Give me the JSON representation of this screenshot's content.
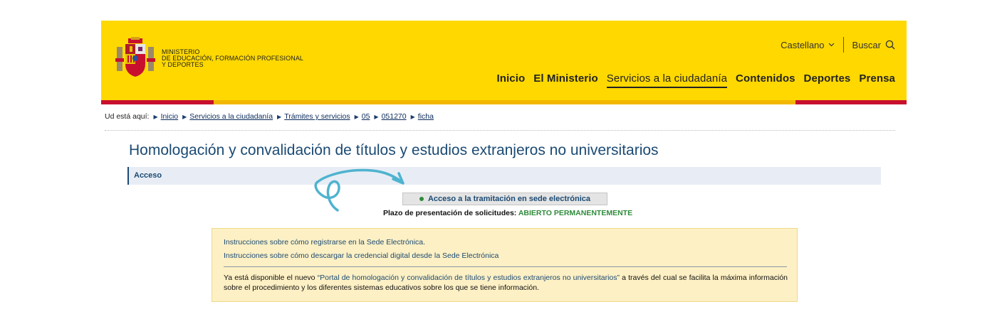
{
  "header": {
    "ministry_lines": [
      "MINISTERIO",
      "DE EDUCACIÓN, FORMACIÓN PROFESIONAL",
      "Y DEPORTES"
    ],
    "language": "Castellano",
    "search_label": "Buscar",
    "nav": [
      {
        "label": "Inicio",
        "active": false
      },
      {
        "label": "El Ministerio",
        "active": false
      },
      {
        "label": "Servicios a la ciudadanía",
        "active": true
      },
      {
        "label": "Contenidos",
        "active": false
      },
      {
        "label": "Deportes",
        "active": false
      },
      {
        "label": "Prensa",
        "active": false
      }
    ]
  },
  "breadcrumb": {
    "label": "Ud está aquí:",
    "items": [
      "Inicio",
      "Servicios a la ciudadanía",
      "Trámites y servicios",
      "05",
      "051270",
      "ficha"
    ]
  },
  "page": {
    "title": "Homologación y convalidación de títulos y estudios extranjeros no universitarios",
    "access_label": "Acceso",
    "tram_button": "Acceso a la tramitación en sede electrónica",
    "plazo_label": "Plazo de presentación de solicitudes:",
    "plazo_status": "ABIERTO PERMANENTEMENTE"
  },
  "info": {
    "link1": "Instrucciones sobre cómo registrarse en la Sede Electrónica.",
    "link2": "Instrucciones sobre cómo descargar la credencial digital desde la Sede Electrónica",
    "para_before": "Ya está disponible el nuevo ",
    "portal_link": "“Portal de homologación y convalidación de títulos y estudios extranjeros no universitarios”",
    "para_after": " a través del cual se facilita la máxima información sobre el procedimiento y los diferentes sistemas educativos sobre los que se tiene información."
  },
  "colors": {
    "header_yellow": "#ffd800",
    "stripe_red": "#c8102e",
    "title_blue": "#1b4a73",
    "status_green": "#2f8a3b",
    "curl_cyan": "#4fb3cf",
    "info_bg": "#fdf0c4"
  }
}
